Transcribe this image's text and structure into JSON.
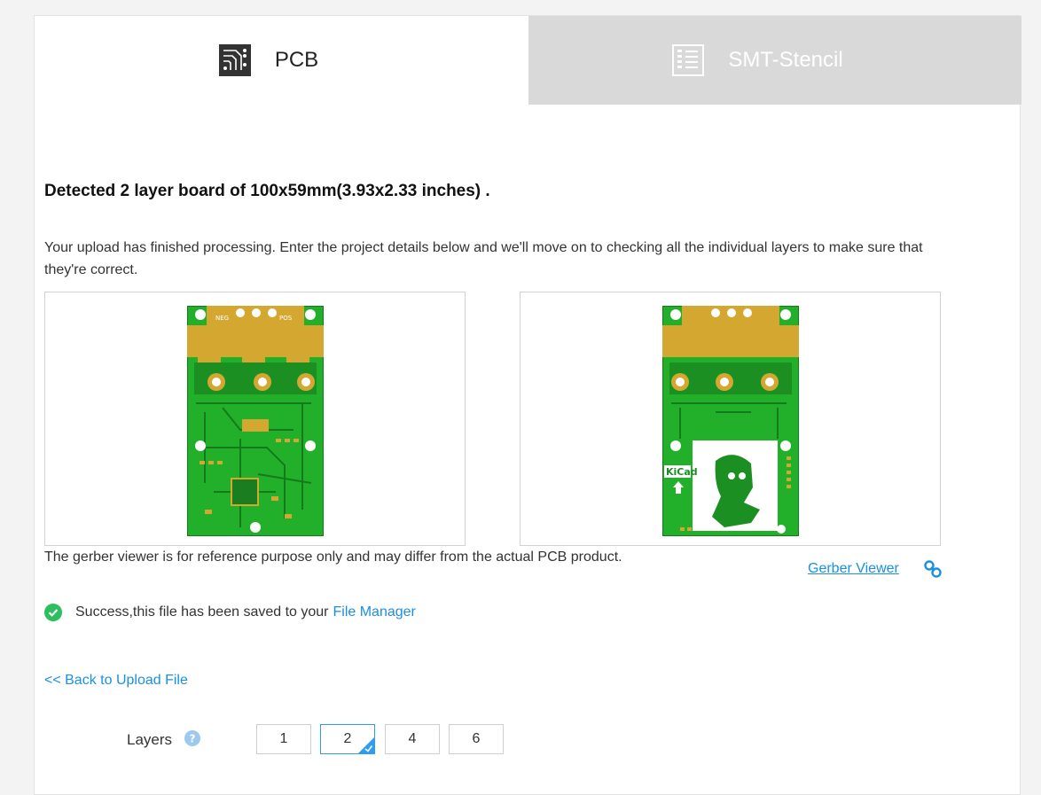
{
  "tabs": [
    {
      "label": "PCB",
      "icon": "pcb-icon",
      "active": true
    },
    {
      "label": "SMT-Stencil",
      "icon": "stencil-icon",
      "active": false
    }
  ],
  "detected_text": "Detected 2 layer board of 100x59mm(3.93x2.33 inches) .",
  "intro_text": "Your upload has finished processing. Enter the project details below and we'll move on to checking all the individual layers to make sure that they're correct.",
  "previews": {
    "top": {
      "silkscreen_left": "NEG",
      "silkscreen_right": "POS"
    },
    "bottom": {
      "logo_text": "KiCad"
    }
  },
  "disclaimer": "The gerber viewer is for reference purpose only and may differ from the actual PCB product.",
  "gerber_viewer_label": "Gerber Viewer",
  "success": {
    "text": "Success,this file has been saved to your",
    "link": "File Manager"
  },
  "back_link": "<< Back to Upload File",
  "layers": {
    "label": "Layers",
    "options": [
      "1",
      "2",
      "4",
      "6"
    ],
    "selected": "2"
  },
  "colors": {
    "accent": "#1a8fe3",
    "pcb_green": "#22b02a",
    "pad_gold": "#d4a830",
    "success": "#2dbe60"
  }
}
